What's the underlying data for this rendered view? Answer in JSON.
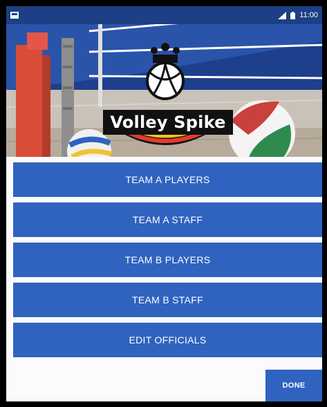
{
  "status_bar": {
    "time": "11:00",
    "icons": [
      "app-notification-icon",
      "signal-icon",
      "battery-icon"
    ]
  },
  "header": {
    "app_title": "Volley Spike"
  },
  "menu": {
    "items": [
      {
        "label": "TEAM A PLAYERS"
      },
      {
        "label": "TEAM A STAFF"
      },
      {
        "label": "TEAM B PLAYERS"
      },
      {
        "label": "TEAM B STAFF"
      },
      {
        "label": "EDIT OFFICIALS"
      }
    ]
  },
  "actions": {
    "done_label": "DONE"
  },
  "colors": {
    "button_blue": "#2f63bf",
    "status_bar": "#1c3f86"
  }
}
